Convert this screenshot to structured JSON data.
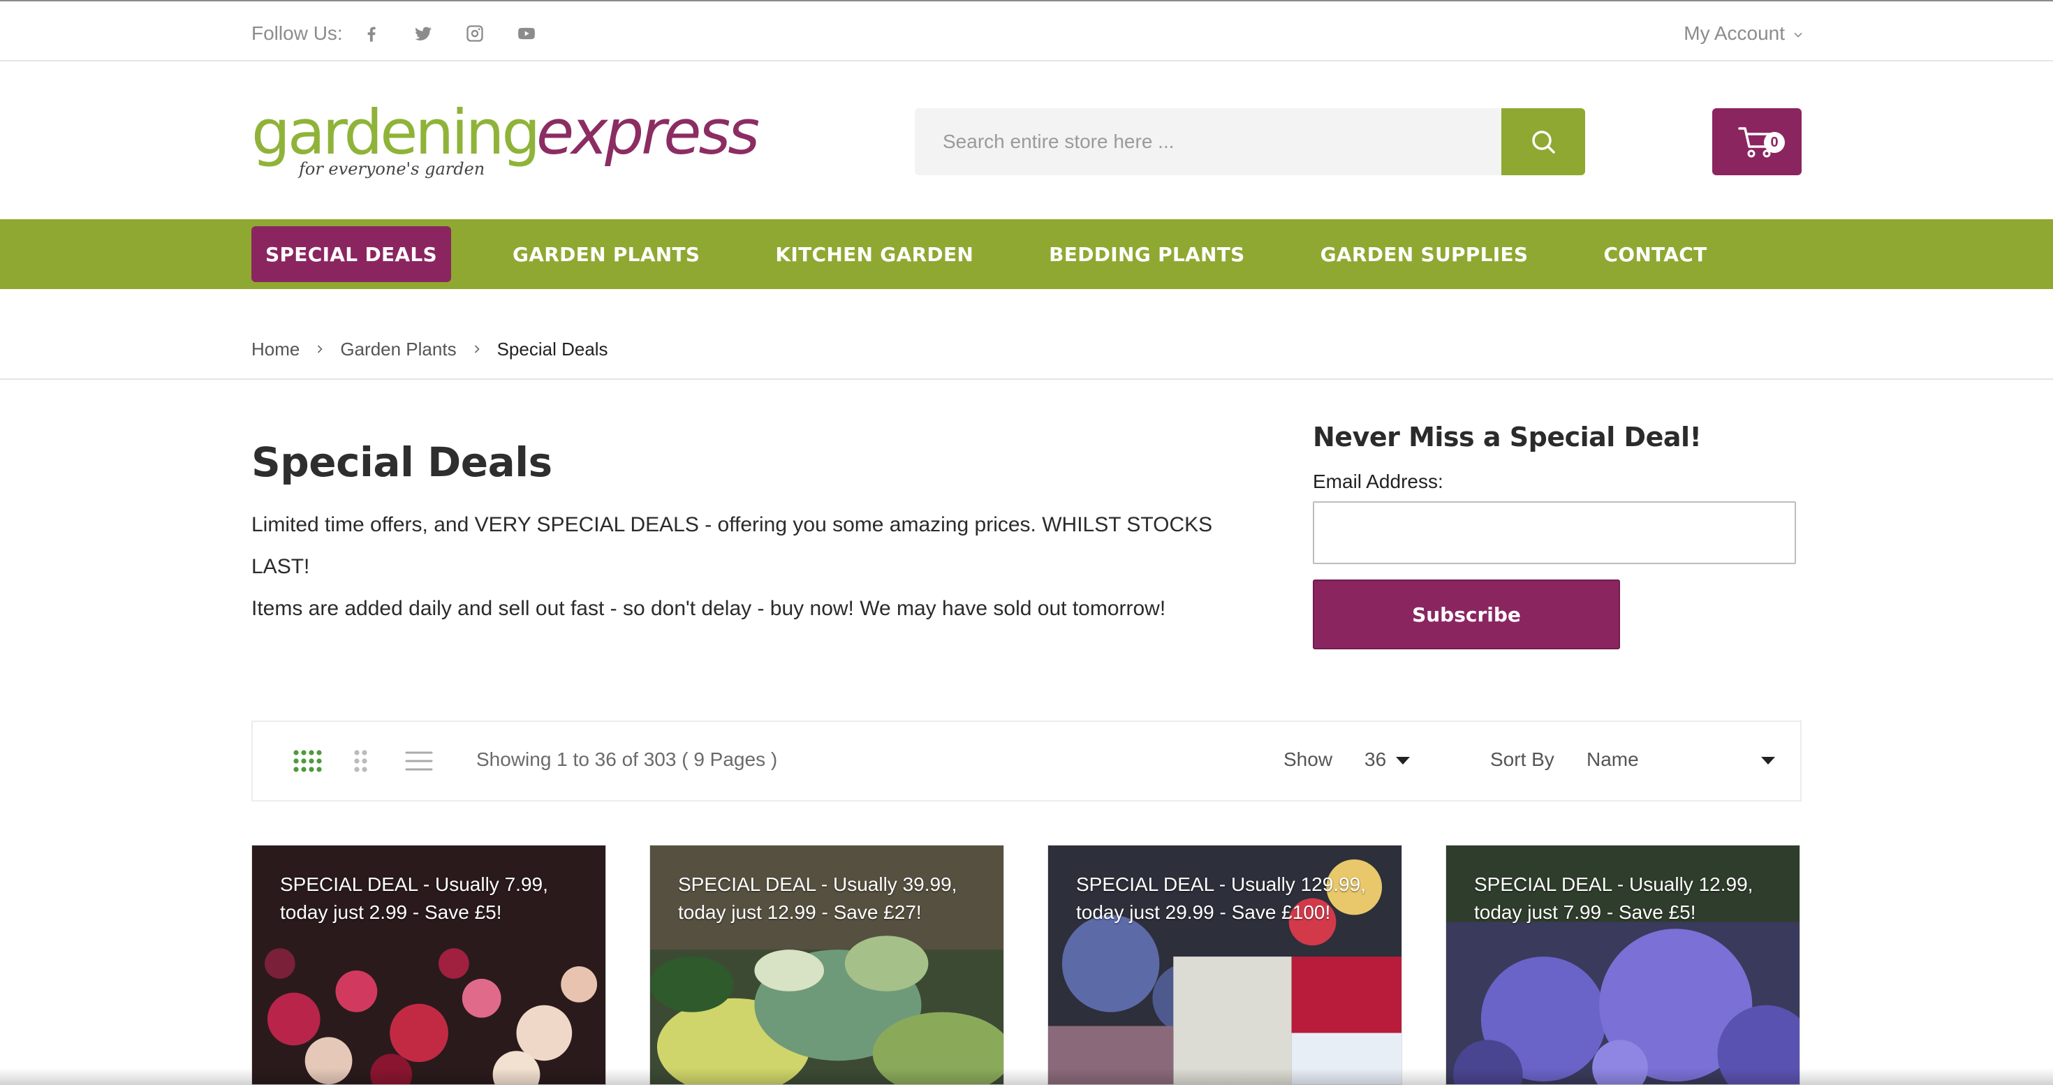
{
  "topbar": {
    "follow_label": "Follow Us:",
    "social": [
      "facebook-icon",
      "twitter-icon",
      "instagram-icon",
      "youtube-icon"
    ],
    "account_label": "My Account"
  },
  "header": {
    "logo": {
      "word1": "gardening",
      "word2": "express",
      "tagline": "for everyone's garden",
      "color_green": "#8fb339",
      "color_purple": "#8b2d62"
    },
    "search_placeholder": "Search entire store here ...",
    "cart_count": "0"
  },
  "nav": {
    "items": [
      {
        "label": "SPECIAL DEALS",
        "active": true
      },
      {
        "label": "GARDEN PLANTS"
      },
      {
        "label": "KITCHEN GARDEN"
      },
      {
        "label": "BEDDING PLANTS"
      },
      {
        "label": "GARDEN SUPPLIES"
      },
      {
        "label": "CONTACT"
      }
    ],
    "bar_color": "#8fa832",
    "active_color": "#8b2560"
  },
  "breadcrumb": [
    "Home",
    "Garden Plants",
    "Special Deals"
  ],
  "page": {
    "title": "Special Deals",
    "intro_line1": "Limited time offers, and VERY SPECIAL DEALS - offering you some amazing prices. WHILST STOCKS LAST!",
    "intro_line2": "Items are added daily and sell out fast - so don't delay - buy now! We may have sold out tomorrow!"
  },
  "newsletter": {
    "title": "Never Miss a Special Deal!",
    "email_label": "Email Address:",
    "email_value": "",
    "button": "Subscribe"
  },
  "toolbar": {
    "showing": "Showing 1 to 36 of 303 ( 9 Pages )",
    "show_label": "Show",
    "show_value": "36",
    "sort_label": "Sort By",
    "sort_value": "Name"
  },
  "products": [
    {
      "caption": "SPECIAL DEAL - Usually 7.99, today just 2.99 - Save £5!"
    },
    {
      "caption": "SPECIAL DEAL - Usually 39.99, today just 12.99 - Save £27!"
    },
    {
      "caption": "SPECIAL DEAL - Usually 129.99, today just 29.99 - Save £100!"
    },
    {
      "caption": "SPECIAL DEAL - Usually 12.99, today just 7.99 - Save £5!"
    }
  ]
}
